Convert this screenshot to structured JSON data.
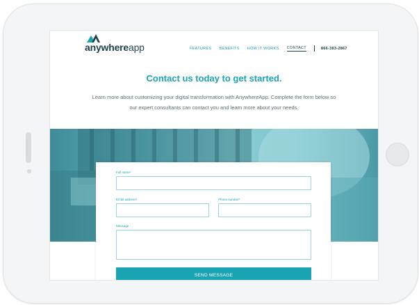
{
  "brand": {
    "name_bold": "anywhere",
    "name_light": "app"
  },
  "nav": {
    "items": [
      "FEATURES",
      "BENEFITS",
      "HOW IT WORKS",
      "CONTACT"
    ],
    "active": "CONTACT",
    "phone": "866-383-2867"
  },
  "hero": {
    "title": "Contact us today to get started.",
    "body": "Learn more about customizing your digital transformation with AnywhereApp. Complete the form below so our expert consultants can contact you and learn more about your needs."
  },
  "form": {
    "full_name_label": "Full name*",
    "email_label": "Email address*",
    "phone_label": "Phone number*",
    "message_label": "Message",
    "submit_label": "SEND MESSAGE"
  },
  "colors": {
    "accent": "#1aa3b2",
    "dark": "#1f3f4c",
    "text": "#5a6b73"
  }
}
